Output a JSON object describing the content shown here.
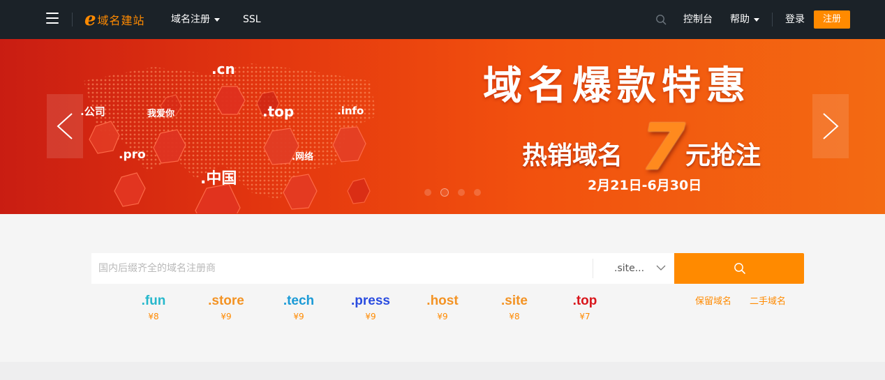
{
  "header": {
    "logo_text": "域名建站",
    "nav": [
      {
        "label": "域名注册",
        "dropdown": true
      },
      {
        "label": "SSL",
        "dropdown": false
      }
    ],
    "right": {
      "console": "控制台",
      "help": "帮助",
      "login": "登录",
      "register": "注册"
    }
  },
  "banner": {
    "title": "域名爆款特惠",
    "promo_left": "热销域名",
    "promo_number": "7",
    "promo_right": "元抢注",
    "date": "2月21日-6月30日",
    "hex_labels": [
      ".cn",
      ".公司",
      "我爱你",
      ".top",
      ".info",
      ".pro",
      ".中国",
      ".网络"
    ],
    "slide_count": 4,
    "active_slide": 2
  },
  "search": {
    "placeholder": "国内后缀齐全的域名注册商",
    "suffix_selected": ".site..."
  },
  "tlds": [
    {
      "name": ".fun",
      "price": "¥8",
      "color": "#27b8cc"
    },
    {
      "name": ".store",
      "price": "¥9",
      "color": "#f39324"
    },
    {
      "name": ".tech",
      "price": "¥9",
      "color": "#1a9ad6"
    },
    {
      "name": ".press",
      "price": "¥9",
      "color": "#2a4ce0"
    },
    {
      "name": ".host",
      "price": "¥9",
      "color": "#f39324"
    },
    {
      "name": ".site",
      "price": "¥8",
      "color": "#f39324"
    },
    {
      "name": ".top",
      "price": "¥7",
      "color": "#d9161c"
    }
  ],
  "side_links": {
    "reserved": "保留域名",
    "secondhand": "二手域名"
  },
  "colors": {
    "accent": "#ff8a00",
    "header_bg": "#1b2228"
  }
}
